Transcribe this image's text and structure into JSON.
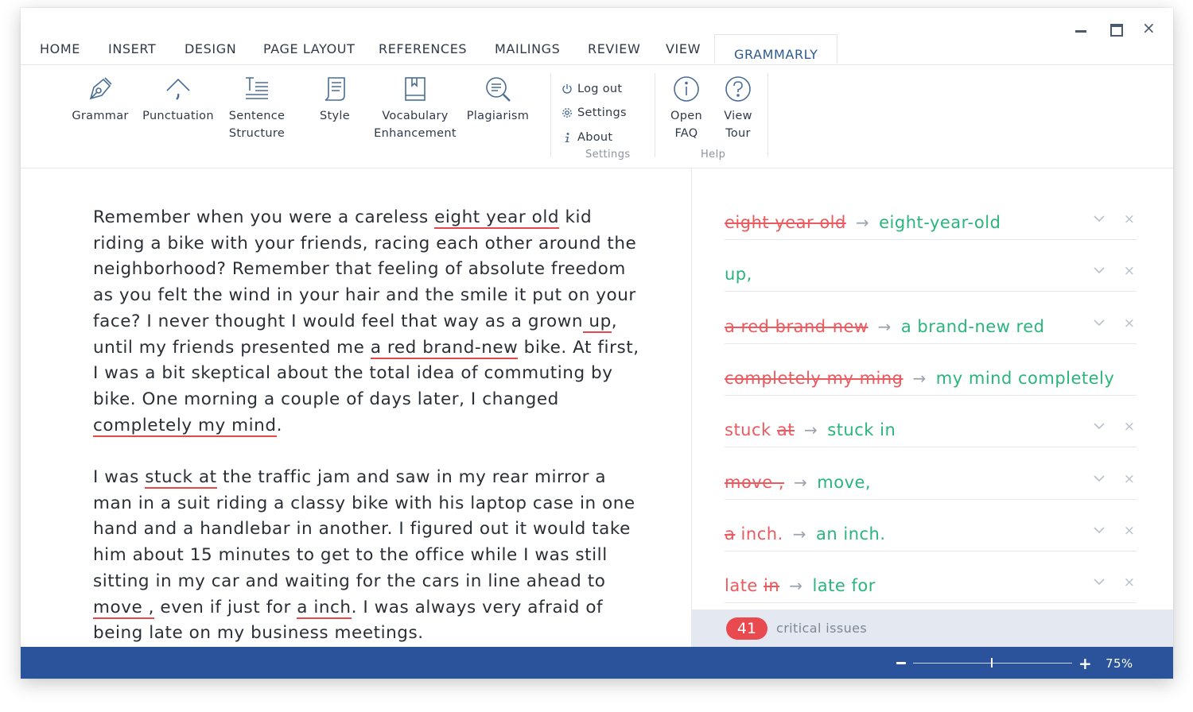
{
  "tabs": [
    {
      "label": "HOME"
    },
    {
      "label": "INSERT"
    },
    {
      "label": "DESIGN"
    },
    {
      "label": "PAGE LAYOUT"
    },
    {
      "label": "REFERENCES"
    },
    {
      "label": "MAILINGS"
    },
    {
      "label": "REVIEW"
    },
    {
      "label": "VIEW"
    },
    {
      "label": "GRAMMARLY"
    }
  ],
  "ribbon": {
    "grammar": "Grammar",
    "punctuation": "Punctuation",
    "sentence_1": "Sentence",
    "sentence_2": "Structure",
    "style": "Style",
    "vocab_1": "Vocabulary",
    "vocab_2": "Enhancement",
    "plagiarism": "Plagiarism",
    "logout": "Log out",
    "settings": "Settings",
    "about": "About",
    "settings_group": "Settings",
    "faq_1": "Open",
    "faq_2": "FAQ",
    "tour_1": "View",
    "tour_2": "Tour",
    "help_group": "Help"
  },
  "document": {
    "p1": {
      "t0": "Remember when you were a careless ",
      "h1": "eight year old",
      "t1": " kid riding a bike with your friends, racing each other around the neighborhood? Remember that feeling of absolute freedom as you felt the wind in your hair and the smile it put on your face? I never thought I would feel that way as a grown",
      "h2": " up",
      "t2": ", until my friends presented me ",
      "h3": "a red brand-new",
      "t3": " bike. At first, I was a bit skeptical about the total idea of commuting by bike. One morning a couple of days later, I changed ",
      "h4": "completely my mind",
      "t4": "."
    },
    "p2": {
      "t0": "I was ",
      "h1": "stuck at",
      "t1": " the traffic jam and saw in my rear mirror a man in a suit riding a classy bike with his laptop case in one hand and a handlebar in another. I figured out it would take him about 15 minutes to get to the office while I was still sitting in my car and waiting for the cars in line ahead to ",
      "h2": "move ,",
      "t2": " even if just for ",
      "h3": "a inch",
      "t3": ". I was always very afraid of being late on my business meetings."
    }
  },
  "suggestions": [
    {
      "plain": "",
      "struck": "eight year old",
      "arrow": "→",
      "replacement": "eight-year-old"
    },
    {
      "plain": "",
      "struck": "",
      "arrow": "",
      "replacement": "up,"
    },
    {
      "plain": "",
      "struck": "a red brand-new",
      "arrow": "→",
      "replacement": "a brand-new red"
    },
    {
      "plain": "",
      "struck": "completely my ming",
      "arrow": "→",
      "replacement": "my mind completely"
    },
    {
      "plain": "stuck ",
      "struck": "at",
      "arrow": "→",
      "replacement": "stuck in"
    },
    {
      "plain": "",
      "struck": "move ,",
      "arrow": "→",
      "replacement": "move,"
    },
    {
      "plain": "",
      "struck": "a",
      "plain_after": " inch.",
      "arrow": "→",
      "replacement": "an inch."
    },
    {
      "plain": "late ",
      "struck": "in",
      "arrow": "→",
      "replacement": "late for"
    }
  ],
  "issues": {
    "count": "41",
    "label": "critical issues"
  },
  "status": {
    "zoom": "75%",
    "zoom_level": 0.49
  },
  "icons": {
    "close": "×",
    "dismiss": "×",
    "plus": "+"
  },
  "colors": {
    "accent": "#2a539b",
    "error": "#e5484d",
    "success": "#29b57b",
    "tab_active": "#2c5a8c"
  }
}
